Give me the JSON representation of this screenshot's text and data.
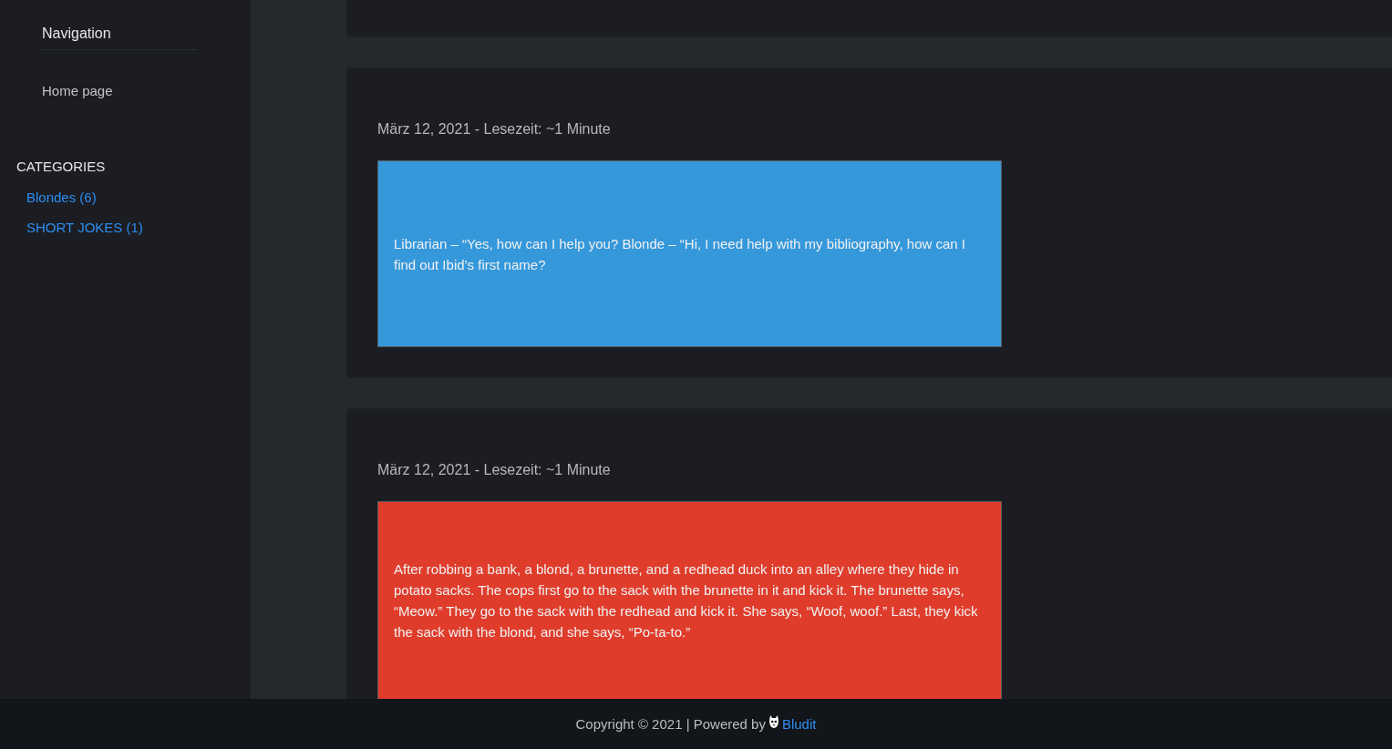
{
  "sidebar": {
    "navigation": {
      "title": "Navigation",
      "items": [
        {
          "label": "Home page"
        }
      ]
    },
    "categories": {
      "title": "CATEGORIES",
      "items": [
        {
          "label": "Blondes (6)"
        },
        {
          "label": "SHORT JOKES (1)"
        }
      ]
    }
  },
  "posts": [
    {
      "meta": "März 12, 2021 - Lesezeit: ~1 Minute",
      "body": "Librarian – “Yes, how can I help you? Blonde – “Hi, I need help with my bibliography, how can I find out Ibid’s first name?",
      "color": "#3598db"
    },
    {
      "meta": "März 12, 2021 - Lesezeit: ~1 Minute",
      "body": "After robbing a bank, a blond, a brunette, and a redhead duck into an alley where they hide in potato sacks. The cops first go to the sack with the brunette in it and kick it. The brunette says, “Meow.” They go to the sack with the redhead and kick it. She says, “Woof, woof.” Last, they kick the sack with the blond, and she says, “Po-ta-to.”",
      "color": "#e03c2b"
    }
  ],
  "footer": {
    "text": "Copyright © 2021 | Powered by",
    "link": "Bludit"
  }
}
